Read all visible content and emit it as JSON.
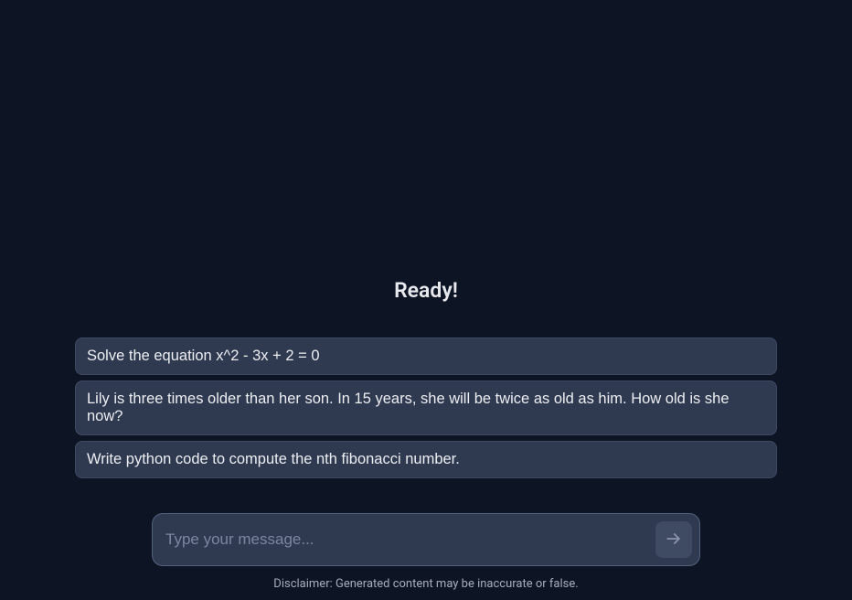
{
  "heading": "Ready!",
  "suggestions": [
    "Solve the equation x^2 - 3x + 2 = 0",
    "Lily is three times older than her son. In 15 years, she will be twice as old as him. How old is she now?",
    "Write python code to compute the nth fibonacci number."
  ],
  "input": {
    "placeholder": "Type your message..."
  },
  "disclaimer": "Disclaimer: Generated content may be inaccurate or false."
}
